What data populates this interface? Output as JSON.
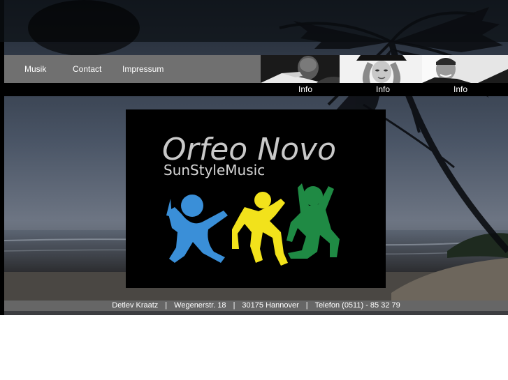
{
  "nav": {
    "items": [
      {
        "label": "Musik"
      },
      {
        "label": "Contact"
      },
      {
        "label": "Impressum"
      }
    ]
  },
  "photos": {
    "info_links": [
      "Info",
      "Info",
      "Info"
    ]
  },
  "logo": {
    "title": "Orfeo Novo",
    "subtitle": "SunStyleMusic",
    "figure_colors": [
      "#3a8fd8",
      "#f2e21b",
      "#1f8a44"
    ]
  },
  "footer": {
    "name": "Detlev Kraatz",
    "street": "Wegenerstr. 18",
    "city": "30175 Hannover",
    "phone": "Telefon (0511) - 85 32 79",
    "separator": "|"
  },
  "colors": {
    "nav_bg": "#707070",
    "footer_bg": "#666666",
    "text": "#ffffff"
  }
}
